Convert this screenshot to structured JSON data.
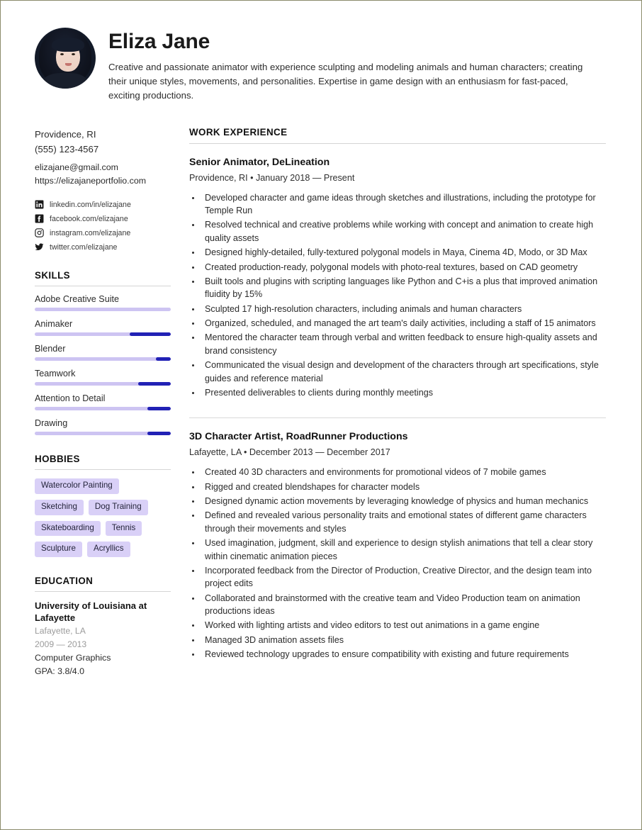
{
  "theme": {
    "page_border": "#8b8b6b",
    "accent_dark": "#2121b5",
    "accent_light": "#cdc4f2",
    "tag_bg": "#d9d0f7"
  },
  "header": {
    "name": "Eliza Jane",
    "summary": "Creative and passionate animator with experience sculpting and modeling animals and human characters; creating their unique styles, movements, and personalities. Expertise in game design with an enthusiasm for fast-paced, exciting productions.",
    "avatar_alt": "profile-photo"
  },
  "contact": {
    "location": "Providence, RI",
    "phone": "(555) 123-4567",
    "email": "elizajane@gmail.com",
    "website": "https://elizajaneportfolio.com",
    "socials": [
      {
        "icon": "linkedin-icon",
        "label": "linkedin.com/in/elizajane"
      },
      {
        "icon": "facebook-icon",
        "label": "facebook.com/elizajane"
      },
      {
        "icon": "instagram-icon",
        "label": "instagram.com/elizajane"
      },
      {
        "icon": "twitter-icon",
        "label": "twitter.com/elizajane"
      }
    ]
  },
  "skills": {
    "title": "SKILLS",
    "items": [
      {
        "name": "Adobe Creative Suite",
        "fill_pct": 0
      },
      {
        "name": "Animaker",
        "fill_pct": 30
      },
      {
        "name": "Blender",
        "fill_pct": 11
      },
      {
        "name": "Teamwork",
        "fill_pct": 24
      },
      {
        "name": "Attention to Detail",
        "fill_pct": 17
      },
      {
        "name": "Drawing",
        "fill_pct": 17
      }
    ]
  },
  "hobbies": {
    "title": "HOBBIES",
    "items": [
      "Watercolor Painting",
      "Sketching",
      "Dog Training",
      "Skateboarding",
      "Tennis",
      "Sculpture",
      "Acryllics"
    ]
  },
  "education": {
    "title": "EDUCATION",
    "school": "University of Louisiana at Lafayette",
    "location": "Lafayette, LA",
    "dates": "2009 — 2013",
    "major": "Computer Graphics",
    "gpa": "GPA: 3.8/4.0"
  },
  "work": {
    "title": "WORK EXPERIENCE",
    "jobs": [
      {
        "title": "Senior Animator, DeLineation",
        "meta": "Providence, RI • January 2018 — Present",
        "bullets": [
          "Developed character and game ideas through sketches and illustrations, including the prototype for Temple Run",
          "Resolved technical and creative problems while working with concept and animation to create high quality assets",
          "Designed highly-detailed, fully-textured polygonal models in Maya, Cinema 4D, Modo, or 3D Max",
          "Created production-ready, polygonal models with photo-real textures, based on CAD geometry",
          "Built tools and plugins with scripting languages like Python and C+is a plus that improved animation fluidity by 15%",
          "Sculpted 17 high-resolution characters, including animals and human characters",
          "Organized, scheduled, and managed the art team's daily activities, including a staff of 15 animators",
          "Mentored the character team through verbal and written feedback to ensure high-quality assets and brand consistency",
          "Communicated the visual design and development of the characters through art specifications, style guides and reference material",
          "Presented deliverables to clients during monthly meetings"
        ]
      },
      {
        "title": "3D Character Artist, RoadRunner Productions",
        "meta": "Lafayette, LA • December 2013 — December 2017",
        "bullets": [
          "Created 40 3D characters and environments for promotional videos of 7 mobile games",
          "Rigged and created blendshapes for character models",
          "Designed dynamic action movements by leveraging knowledge of physics and human mechanics",
          "Defined and revealed various personality traits and emotional states of different game characters through their movements and styles",
          "Used imagination, judgment, skill and experience to design stylish animations that tell a clear story within cinematic animation pieces",
          "Incorporated feedback from the Director of Production, Creative Director, and the design team into project edits",
          "Collaborated and brainstormed with the creative team and Video Production team on animation productions ideas",
          "Worked with lighting artists and video editors to test out animations in a game engine",
          "Managed 3D animation assets files",
          "Reviewed technology upgrades to ensure compatibility with existing and future requirements"
        ]
      }
    ]
  }
}
